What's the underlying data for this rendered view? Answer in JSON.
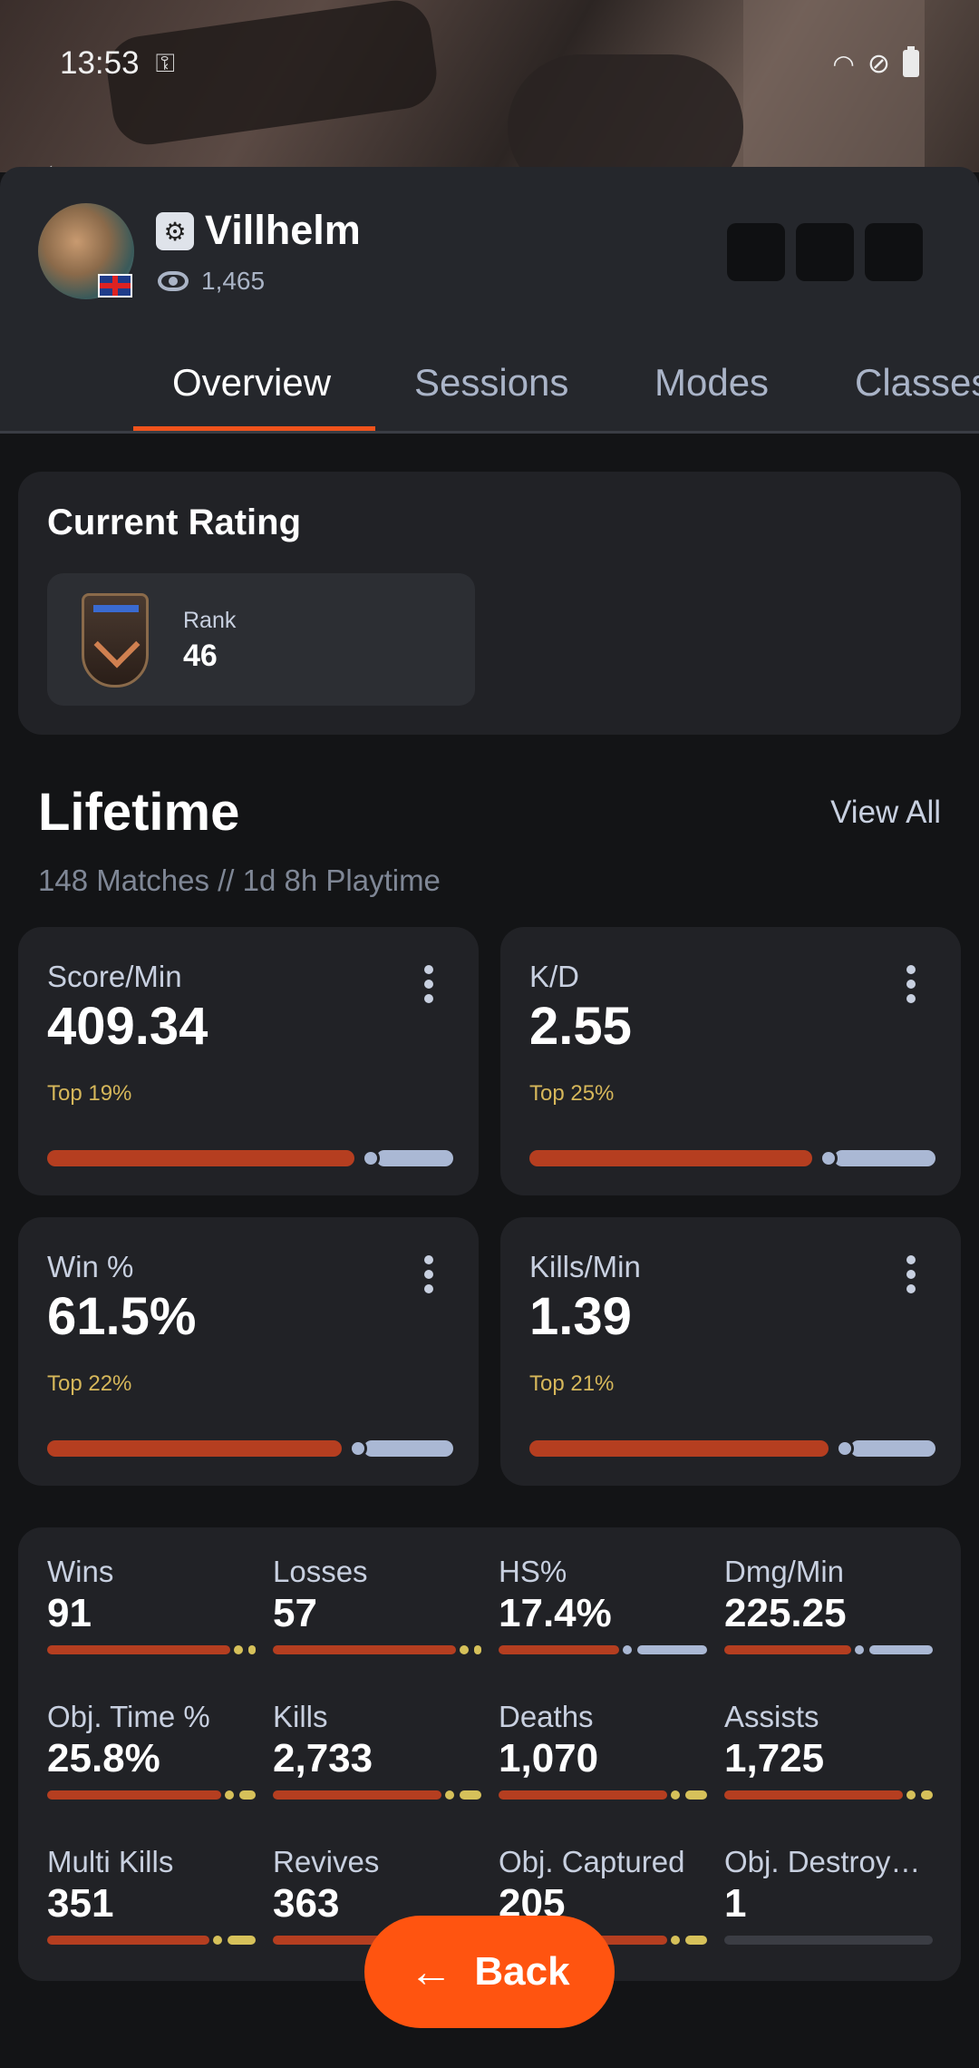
{
  "status_bar": {
    "time": "13:53"
  },
  "profile": {
    "name": "Villhelm",
    "views": "1,465"
  },
  "tabs": [
    "Overview",
    "Sessions",
    "Modes",
    "Classes"
  ],
  "current_rating": {
    "title": "Current Rating",
    "rank_label": "Rank",
    "rank_value": "46"
  },
  "lifetime": {
    "title": "Lifetime",
    "view_all": "View All",
    "subtitle": "148 Matches // 1d 8h Playtime",
    "cards": [
      {
        "label": "Score/Min",
        "value": "409.34",
        "top": "Top 19%",
        "fill": 0.81
      },
      {
        "label": "K/D",
        "value": "2.55",
        "top": "Top 25%",
        "fill": 0.75
      },
      {
        "label": "Win %",
        "value": "61.5%",
        "top": "Top 22%",
        "fill": 0.78
      },
      {
        "label": "Kills/Min",
        "value": "1.39",
        "top": "Top 21%",
        "fill": 0.79
      }
    ]
  },
  "stats": [
    {
      "label": "Wins",
      "value": "91",
      "fill": 0.92,
      "rest": "gold"
    },
    {
      "label": "Losses",
      "value": "57",
      "fill": 0.92,
      "rest": "gold"
    },
    {
      "label": "HS%",
      "value": "17.4%",
      "fill": 0.62,
      "rest": "blue"
    },
    {
      "label": "Dmg/Min",
      "value": "225.25",
      "fill": 0.65,
      "rest": "blue"
    },
    {
      "label": "Obj. Time %",
      "value": "25.8%",
      "fill": 0.88,
      "rest": "gold"
    },
    {
      "label": "Kills",
      "value": "2,733",
      "fill": 0.85,
      "rest": "gold"
    },
    {
      "label": "Deaths",
      "value": "1,070",
      "fill": 0.85,
      "rest": "gold"
    },
    {
      "label": "Assists",
      "value": "1,725",
      "fill": 0.9,
      "rest": "gold"
    },
    {
      "label": "Multi Kills",
      "value": "351",
      "fill": 0.82,
      "rest": "gold"
    },
    {
      "label": "Revives",
      "value": "363",
      "fill": 0.85,
      "rest": "gold"
    },
    {
      "label": "Obj. Captured",
      "value": "205",
      "fill": 0.85,
      "rest": "gold"
    },
    {
      "label": "Obj. Destroy…",
      "value": "1",
      "fill": 0.0,
      "rest": "dark"
    }
  ],
  "fab": {
    "label": "Back"
  }
}
